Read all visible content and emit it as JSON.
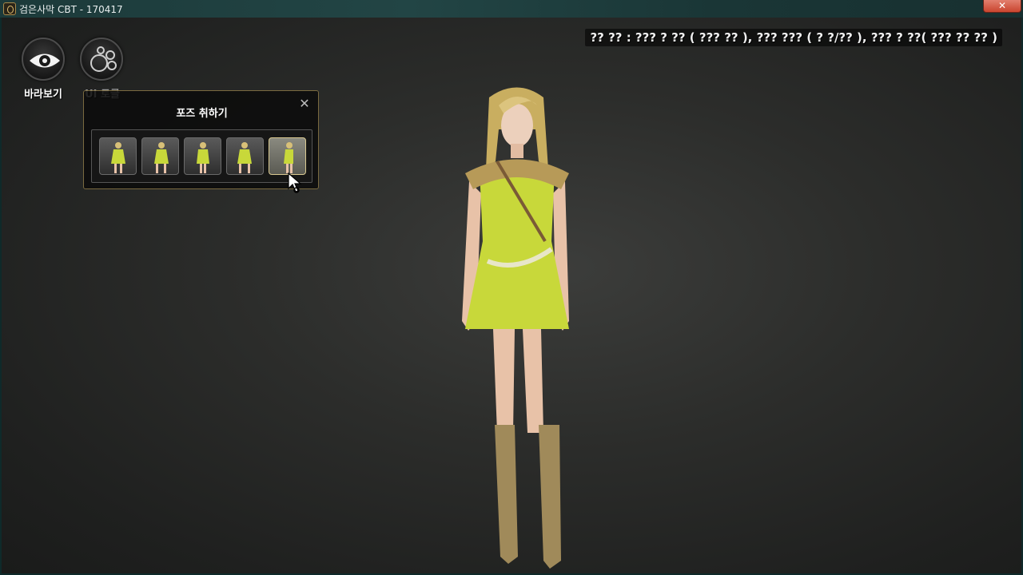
{
  "window": {
    "title": "검은사막 CBT - 170417",
    "close_glyph": "✕"
  },
  "status": {
    "text": "?? ?? : ??? ? ?? ( ??? ?? ), ??? ??? ( ? ?/?? ), ??? ? ??( ??? ?? ?? )"
  },
  "toolbar": {
    "look_label": "바라보기",
    "ui_toggle_label": "UI 토글"
  },
  "pose_panel": {
    "title": "포즈 취하기",
    "close_glyph": "✕",
    "poses": [
      {
        "selected": false
      },
      {
        "selected": false
      },
      {
        "selected": false
      },
      {
        "selected": false
      },
      {
        "selected": true
      }
    ]
  },
  "colors": {
    "dress": "#c8d83a",
    "hair": "#d8c078",
    "boots": "#a08a5a",
    "skin": "#e8c2a8"
  }
}
